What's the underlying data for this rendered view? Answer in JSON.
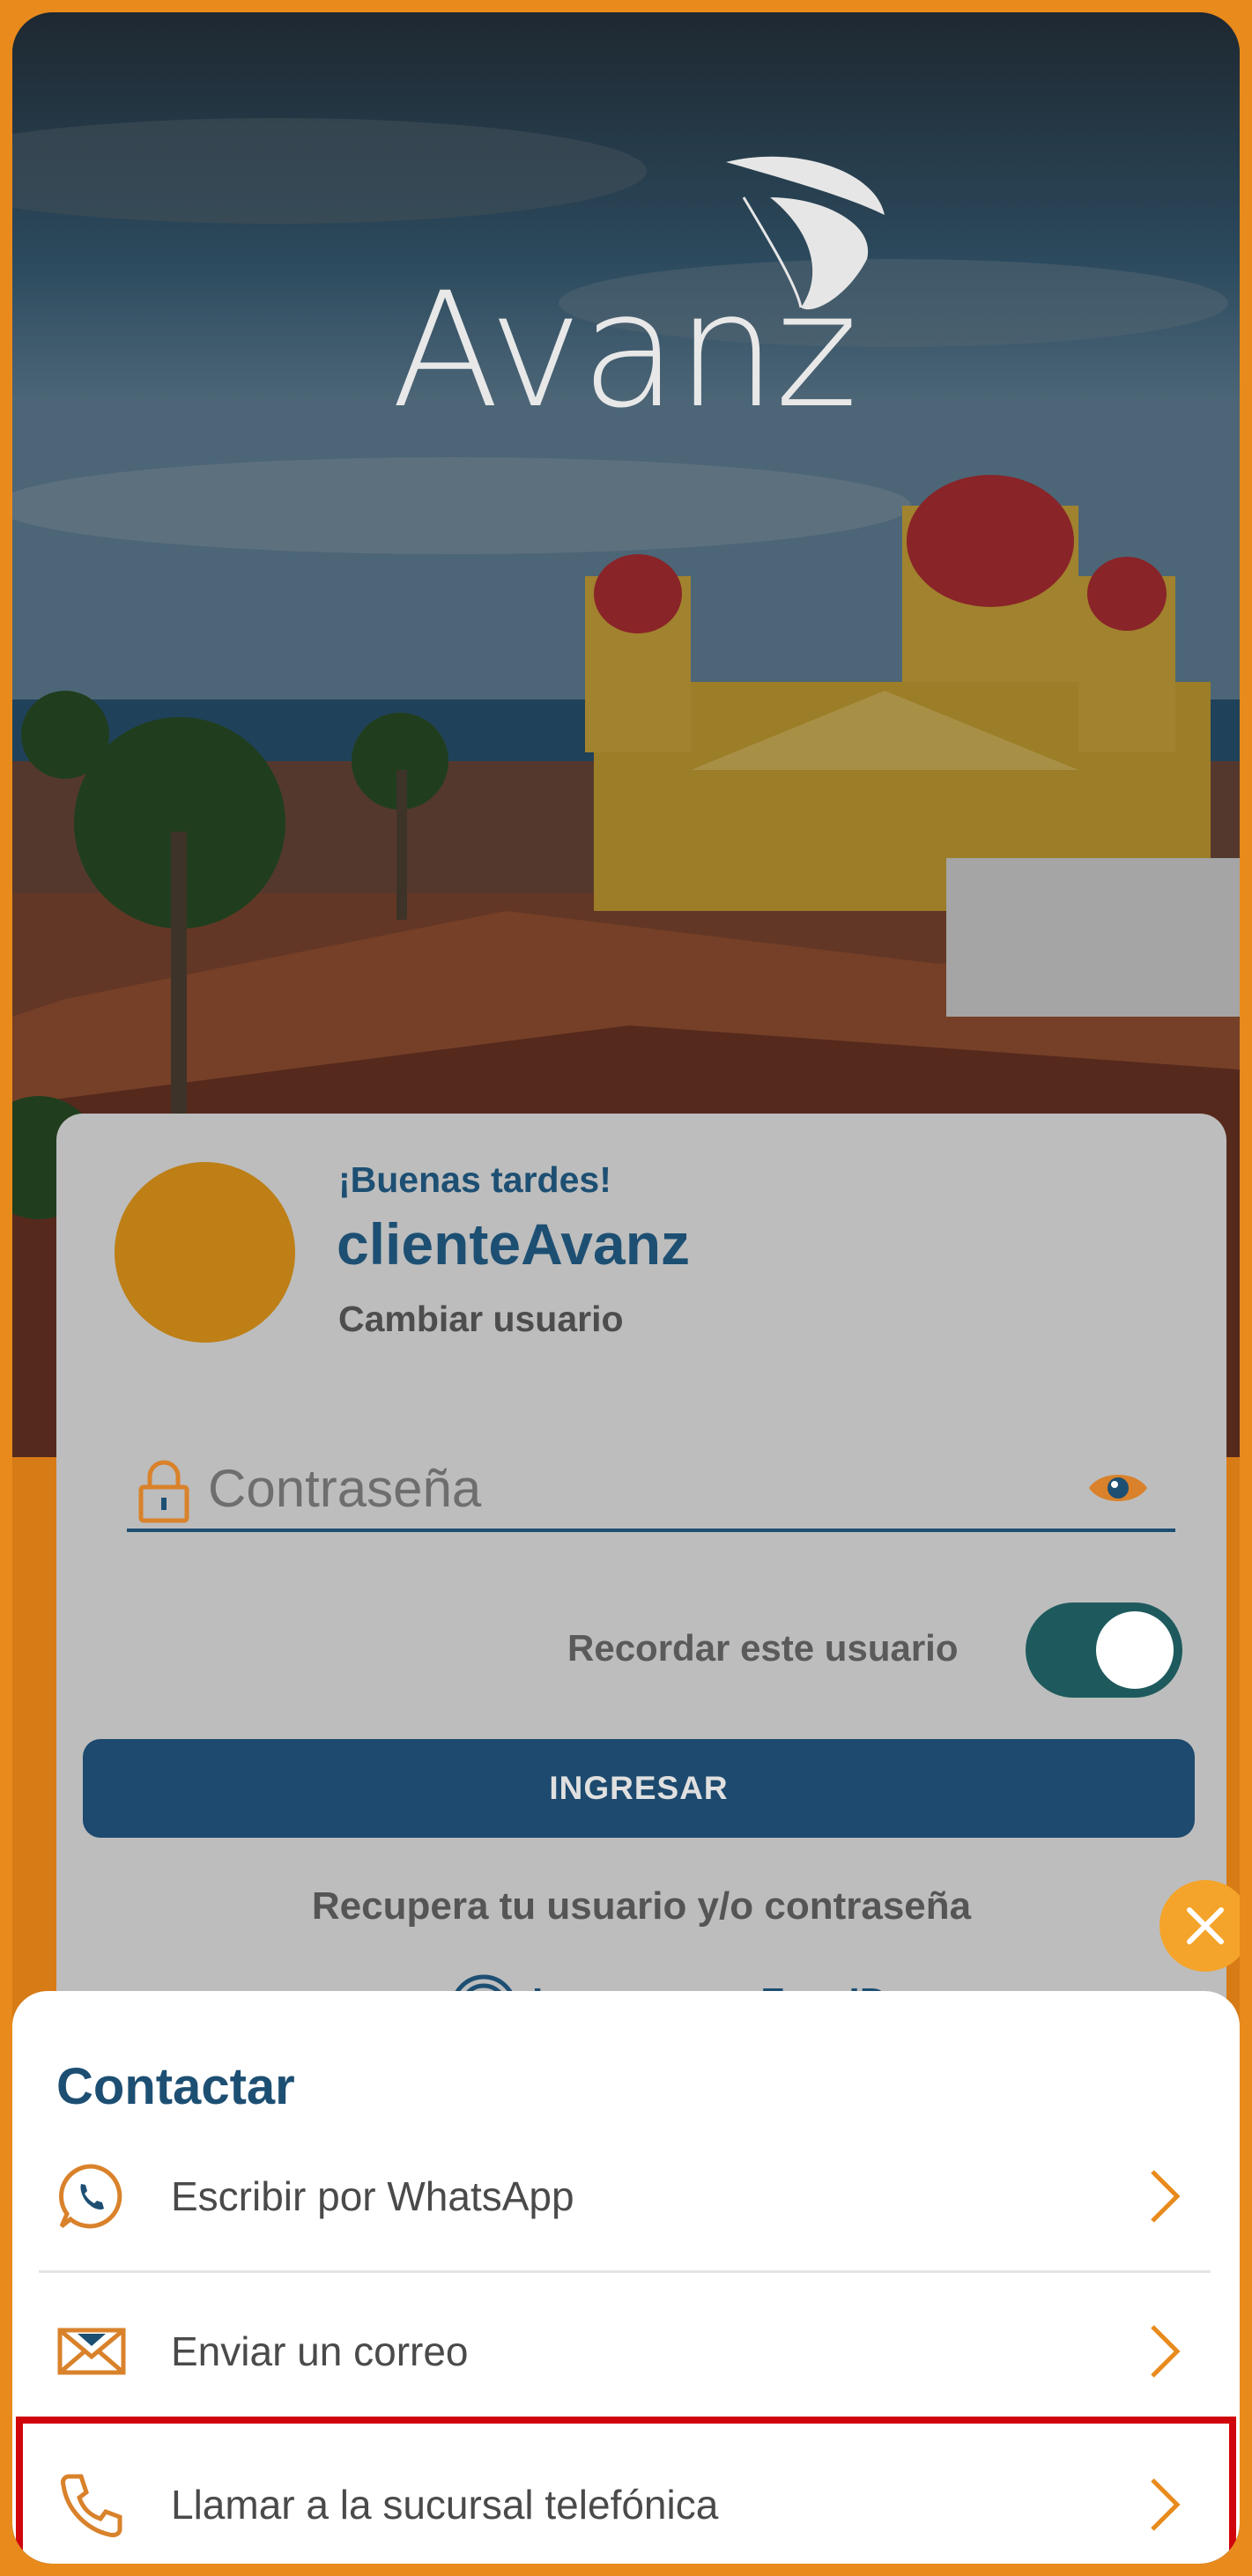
{
  "brand": {
    "logo_text": "Avanz"
  },
  "login": {
    "greeting": "¡Buenas tardes!",
    "username": "clienteAvanz",
    "change_user": "Cambiar usuario",
    "password_placeholder": "Contraseña",
    "remember_label": "Recordar este usuario",
    "remember_on": true,
    "login_button": "INGRESAR",
    "recover_link": "Recupera tu usuario y/o contraseña",
    "faceid_link": "Ingresa con FaceID"
  },
  "contact_sheet": {
    "title": "Contactar",
    "items": [
      {
        "label": "Escribir por WhatsApp",
        "icon": "whatsapp-icon"
      },
      {
        "label": "Enviar un correo",
        "icon": "envelope-icon"
      },
      {
        "label": "Llamar a la sucursal telefónica",
        "icon": "phone-icon"
      }
    ]
  },
  "colors": {
    "brand_blue": "#1d4f73",
    "brand_orange": "#e88a1c",
    "toggle_on": "#1e5a5d",
    "highlight_red": "#d0040b"
  }
}
